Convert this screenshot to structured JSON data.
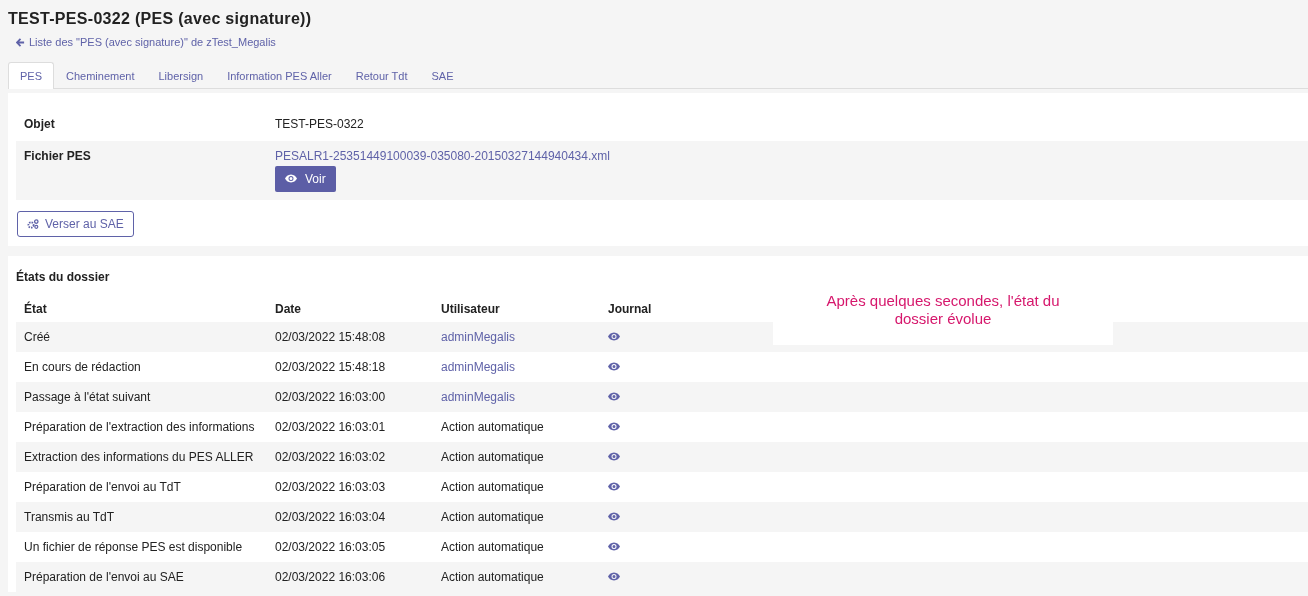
{
  "title": "TEST-PES-0322 (PES (avec signature))",
  "back_link": "Liste des \"PES (avec signature)\" de zTest_Megalis",
  "tabs": [
    {
      "label": "PES",
      "selected": true
    },
    {
      "label": "Cheminement",
      "selected": false
    },
    {
      "label": "Libersign",
      "selected": false
    },
    {
      "label": "Information PES Aller",
      "selected": false
    },
    {
      "label": "Retour Tdt",
      "selected": false
    },
    {
      "label": "SAE",
      "selected": false
    }
  ],
  "fields": [
    {
      "label": "Objet",
      "kind": "text",
      "value": "TEST-PES-0322"
    },
    {
      "label": "Fichier PES",
      "kind": "file",
      "value": "PESALR1-25351449100039-035080-20150327144940434.xml",
      "button": "Voir"
    }
  ],
  "archive_button": "Verser au SAE",
  "states": {
    "heading": "États du dossier",
    "columns": [
      "État",
      "Date",
      "Utilisateur",
      "Journal"
    ],
    "rows": [
      {
        "state": "Créé",
        "date": "02/03/2022 15:48:08",
        "user": "adminMegalis",
        "kind": "link"
      },
      {
        "state": "En cours de rédaction",
        "date": "02/03/2022 15:48:18",
        "user": "adminMegalis",
        "kind": "link"
      },
      {
        "state": "Passage à l'état suivant",
        "date": "02/03/2022 16:03:00",
        "user": "adminMegalis",
        "kind": "link"
      },
      {
        "state": "Préparation de l'extraction des informations",
        "date": "02/03/2022 16:03:01",
        "user": "Action automatique",
        "kind": "text"
      },
      {
        "state": "Extraction des informations du PES ALLER",
        "date": "02/03/2022 16:03:02",
        "user": "Action automatique",
        "kind": "text"
      },
      {
        "state": "Préparation de l'envoi au TdT",
        "date": "02/03/2022 16:03:03",
        "user": "Action automatique",
        "kind": "text"
      },
      {
        "state": "Transmis au TdT",
        "date": "02/03/2022 16:03:04",
        "user": "Action automatique",
        "kind": "text"
      },
      {
        "state": "Un fichier de réponse PES est disponible",
        "date": "02/03/2022 16:03:05",
        "user": "Action automatique",
        "kind": "text"
      },
      {
        "state": "Préparation de l'envoi au SAE",
        "date": "02/03/2022 16:03:06",
        "user": "Action automatique",
        "kind": "text"
      }
    ]
  },
  "annotation": "Après quelques secondes, l'état du dossier évolue"
}
